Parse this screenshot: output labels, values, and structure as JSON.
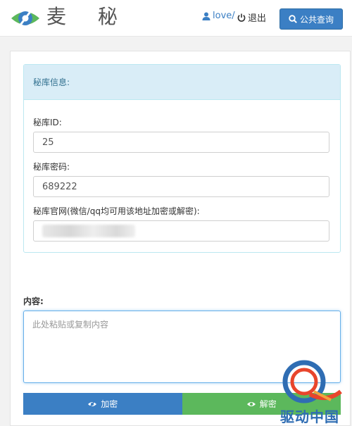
{
  "header": {
    "brand": "麦 秘",
    "user_label": "love/",
    "logout_label": "退出",
    "public_query_label": "公共查询"
  },
  "panel": {
    "title": "秘库信息:",
    "fields": [
      {
        "label": "秘库ID:",
        "value": "25"
      },
      {
        "label": "秘库密码:",
        "value": "689222"
      },
      {
        "label": "秘库官网(微信/qq均可用该地址加密或解密):",
        "value": ""
      }
    ]
  },
  "content": {
    "label": "内容:",
    "placeholder": "此处粘贴或复制内容"
  },
  "actions": {
    "encrypt_label": "加密",
    "decrypt_label": "解密"
  },
  "watermark": {
    "text": "驱动中国"
  },
  "colors": {
    "primary": "#3b7fc4",
    "success": "#5cb85c",
    "panel_head": "#d9edf7",
    "panel_text": "#31708f"
  }
}
